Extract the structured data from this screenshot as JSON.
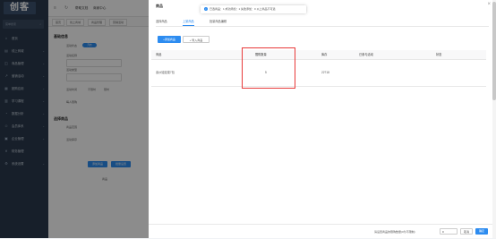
{
  "app": {
    "logo": "创客",
    "search_placeholder": "菜单搜索",
    "nav": [
      {
        "icon": "home",
        "label": "首页"
      },
      {
        "icon": "store",
        "label": "线上商城"
      },
      {
        "icon": "bag",
        "label": "商品管理"
      },
      {
        "icon": "chart",
        "label": "营销活动"
      },
      {
        "icon": "grid",
        "label": "团购应用"
      },
      {
        "icon": "book",
        "label": "学习课程"
      },
      {
        "icon": "pie",
        "label": "数据分析"
      },
      {
        "icon": "user",
        "label": "会员体系"
      },
      {
        "icon": "building",
        "label": "企业管理"
      },
      {
        "icon": "cash",
        "label": "财务管理"
      },
      {
        "icon": "gear",
        "label": "系统设置"
      }
    ]
  },
  "topbar": {
    "item1": "帮助文档",
    "item2": "商家中心"
  },
  "tabs": [
    "首页",
    "线上商城",
    "商品管理",
    "营销活动"
  ],
  "background_form": {
    "section1": "基础信息",
    "label_status": "活动状态",
    "toggle": "开启",
    "label_name": "活动名称",
    "label_type": "活动类型",
    "label_time": "活动时间",
    "radio1": "不限时",
    "radio2": "限时",
    "label_limit": "每人限购",
    "section2": "选择商品",
    "label_scope": "商品范围",
    "label_stock": "活动库存",
    "btn1": "添加商品",
    "btn2": "批量设置",
    "table_col": "商品"
  },
  "dialog": {
    "title": "商品",
    "toast": "已选商品：1 成功添加：1 失败添加：0 以上商品不可选",
    "tabs": [
      "选择商品",
      "上架商品",
      "批量商品编辑"
    ],
    "active_tab": 1,
    "add_button": "+添加商品",
    "import_button": "+ 导入商品",
    "columns": [
      "商品",
      "限购数量",
      "库存",
      "已参与活动",
      "状态"
    ],
    "rows": [
      {
        "name": "素炒娃娃菜7包",
        "limit": "5",
        "stock": "22718",
        "joined": "",
        "status": ""
      }
    ],
    "footer_label": "请设置商品的限购数量(0为不限制)",
    "footer_value": "0",
    "cancel": "取消",
    "confirm": "确定"
  },
  "colors": {
    "sidebar": "#2b3a4d",
    "accent": "#2d8cf0",
    "highlight": "#e83a3a"
  }
}
